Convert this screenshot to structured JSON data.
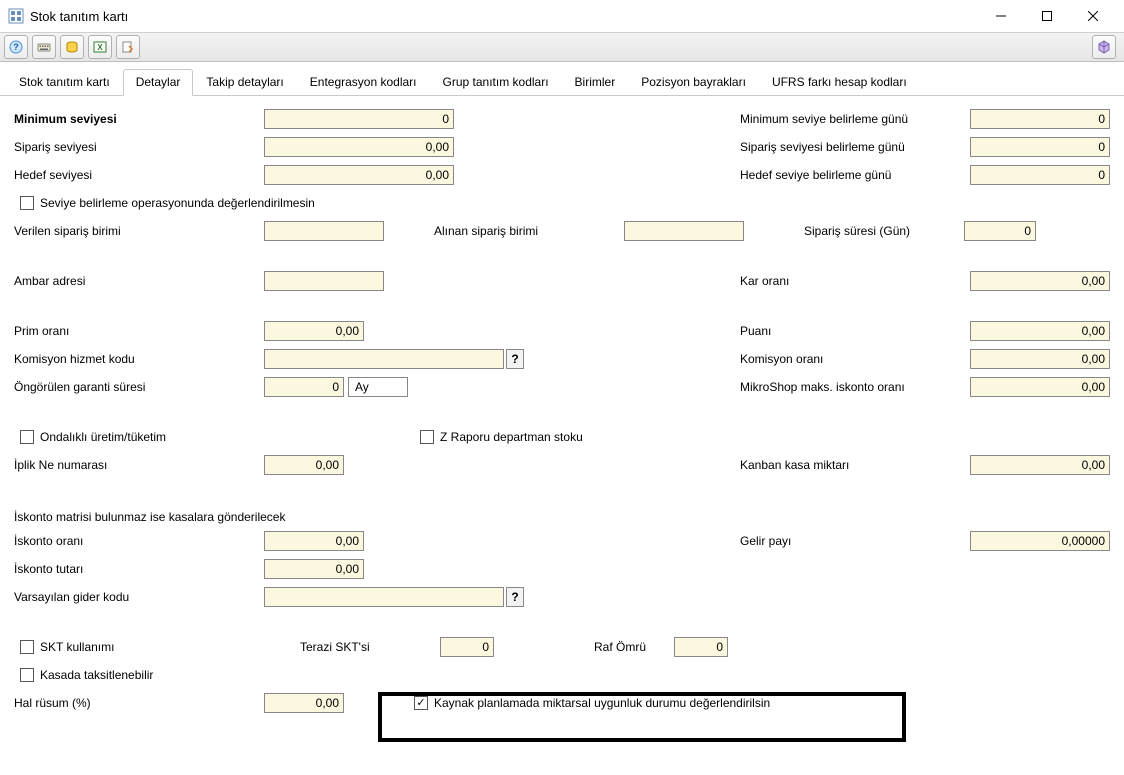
{
  "window": {
    "title": "Stok tanıtım kartı"
  },
  "tabs": {
    "t0": "Stok tanıtım kartı",
    "t1": "Detaylar",
    "t2": "Takip detayları",
    "t3": "Entegrasyon kodları",
    "t4": "Grup tanıtım kodları",
    "t5": "Birimler",
    "t6": "Pozisyon bayrakları",
    "t7": "UFRS farkı hesap kodları"
  },
  "labels": {
    "minimum_seviyesi": "Minimum seviyesi",
    "siparis_seviyesi": "Sipariş seviyesi",
    "hedef_seviyesi": "Hedef seviyesi",
    "min_seviye_gunu": "Minimum seviye belirleme günü",
    "siparis_seviye_gunu": "Sipariş seviyesi belirleme günü",
    "hedef_seviye_gunu": "Hedef seviye belirleme günü",
    "seviye_belirleme_op": "Seviye belirleme operasyonunda değerlendirilmesin",
    "verilen_siparis_birimi": "Verilen sipariş birimi",
    "alinan_siparis_birimi": "Alınan sipariş birimi",
    "siparis_suresi": "Sipariş süresi (Gün)",
    "ambar_adresi": "Ambar adresi",
    "kar_orani": "Kar oranı",
    "prim_orani": "Prim oranı",
    "puani": "Puanı",
    "komisyon_hizmet_kodu": "Komisyon hizmet kodu",
    "komisyon_orani": "Komisyon oranı",
    "ongorulen_garanti": "Öngörülen garanti süresi",
    "ay": "Ay",
    "mikroshop_iskonto": "MikroShop maks. iskonto oranı",
    "ondalikli_uretim": "Ondalıklı üretim/tüketim",
    "z_raporu": "Z Raporu departman stoku",
    "iplik_ne": "İplik Ne numarası",
    "kanban_kasa": "Kanban kasa miktarı",
    "iskonto_matrisi_baslik": "İskonto matrisi bulunmaz ise kasalara gönderilecek",
    "iskonto_orani": "İskonto oranı",
    "gelir_payi": "Gelir payı",
    "iskonto_tutari": "İskonto tutarı",
    "varsayilan_gider": "Varsayılan gider kodu",
    "skt_kullanimi": "SKT kullanımı",
    "terazi_skt": "Terazi SKT'si",
    "raf_omru": "Raf Ömrü",
    "kasada_taksit": "Kasada taksitlenebilir",
    "hal_rusum": "Hal rüsum (%)",
    "kaynak_planlama": "Kaynak planlamada miktarsal uygunluk durumu değerlendirilsin"
  },
  "values": {
    "minimum_seviyesi": "0",
    "siparis_seviyesi": "0,00",
    "hedef_seviyesi": "0,00",
    "min_seviye_gunu": "0",
    "siparis_seviye_gunu": "0",
    "hedef_seviye_gunu": "0",
    "verilen_siparis_birimi": "",
    "alinan_siparis_birimi": "",
    "siparis_suresi": "0",
    "ambar_adresi": "",
    "kar_orani": "0,00",
    "prim_orani": "0,00",
    "puani": "0,00",
    "komisyon_hizmet_kodu": "",
    "komisyon_orani": "0,00",
    "ongorulen_garanti": "0",
    "mikroshop_iskonto": "0,00",
    "iplik_ne": "0,00",
    "kanban_kasa": "0,00",
    "iskonto_orani": "0,00",
    "gelir_payi": "0,00000",
    "iskonto_tutari": "0,00",
    "varsayilan_gider": "",
    "terazi_skt": "0",
    "raf_omru": "0",
    "hal_rusum": "0,00"
  },
  "checks": {
    "seviye_belirleme_op": false,
    "ondalikli_uretim": false,
    "z_raporu": false,
    "skt_kullanimi": false,
    "kasada_taksit": false,
    "kaynak_planlama": true
  },
  "qmark": "?"
}
